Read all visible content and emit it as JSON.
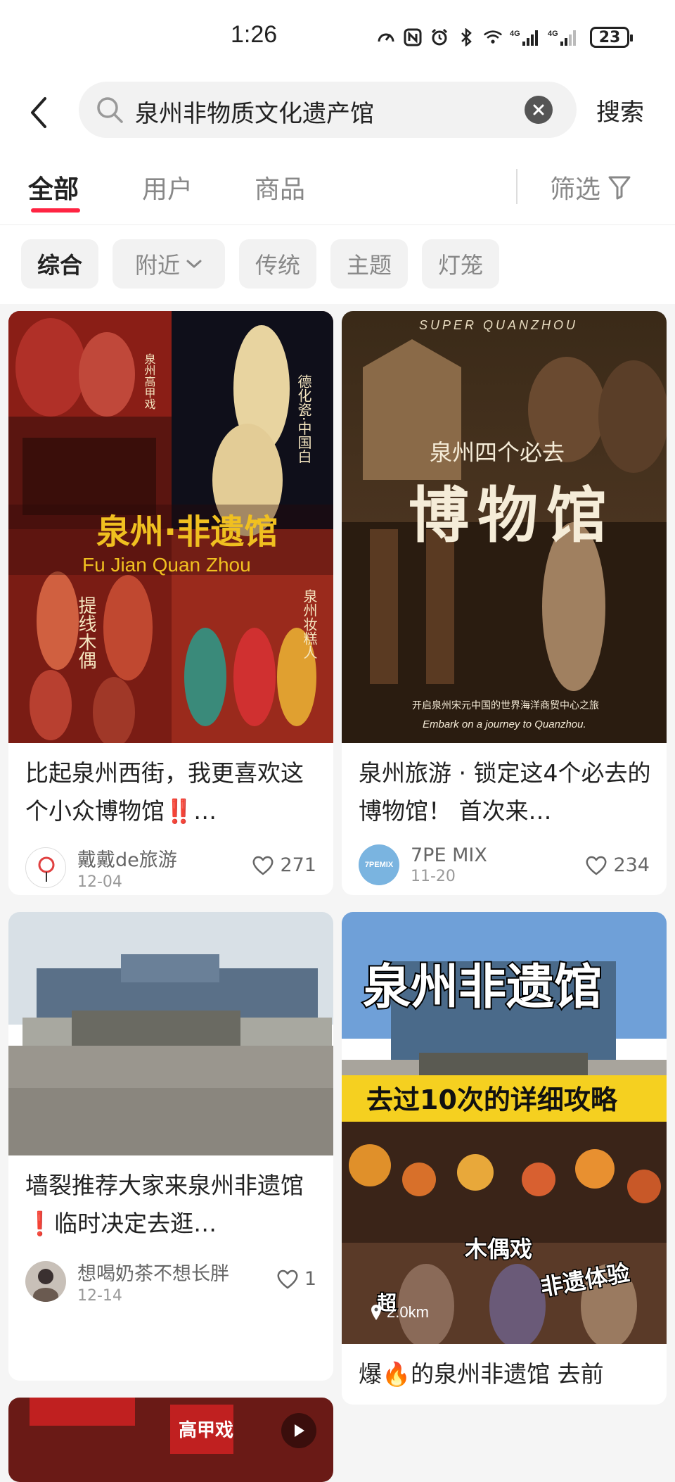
{
  "status_bar": {
    "time": "1:26",
    "battery": "23",
    "signal_labels": [
      "4G",
      "4G"
    ]
  },
  "search": {
    "query": "泉州非物质文化遗产馆",
    "button_label": "搜索"
  },
  "tabs": [
    {
      "label": "全部"
    },
    {
      "label": "用户"
    },
    {
      "label": "商品"
    }
  ],
  "filter_label": "筛选",
  "chips": [
    {
      "label": "综合"
    },
    {
      "label": "附近"
    },
    {
      "label": "传统"
    },
    {
      "label": "主题"
    },
    {
      "label": "灯笼"
    }
  ],
  "cards": [
    {
      "title": "比起泉州西街，我更喜欢这个小众博物馆‼️…",
      "author": "戴戴de旅游",
      "date": "12-04",
      "likes": "271",
      "image_text": {
        "main": "泉州·非遗馆",
        "sub": "Fu Jian Quan Zhou",
        "label1": "德化瓷·中国白",
        "label2": "泉州高甲戏",
        "label3": "提线木偶",
        "label4": "泉州妆糕人"
      }
    },
    {
      "title": "泉州旅游 · 锁定这4个必去的博物馆！ 首次来…",
      "author": "7PE MIX",
      "date": "11-20",
      "likes": "234",
      "avatar_text": "7PEMIX",
      "image_text": {
        "top": "SUPER QUANZHOU",
        "line1": "泉州四个必去",
        "main": "博物馆",
        "cn_sub": "开启泉州宋元中国的世界海洋商贸中心之旅",
        "en_sub": "Embark on a journey to Quanzhou."
      }
    },
    {
      "title": "墙裂推荐大家来泉州非遗馆❗️临时决定去逛…",
      "author": "想喝奶茶不想长胖",
      "date": "12-14",
      "likes": "1"
    },
    {
      "title": "爆🔥的泉州非遗馆 去前",
      "image_text": {
        "main": "泉州非遗馆",
        "banner": "去过10次的详细攻略",
        "tag1": "木偶戏",
        "tag2": "非遗体验",
        "tag3": "超"
      },
      "distance": "2.0km"
    },
    {
      "image_text": {
        "sign1": "高甲戏"
      }
    }
  ]
}
